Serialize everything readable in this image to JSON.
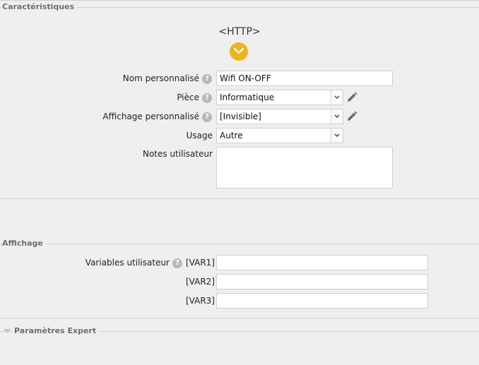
{
  "sections": {
    "characteristics": "Caractéristiques",
    "display": "Affichage",
    "expert": "Paramètres Expert"
  },
  "device": {
    "title": "<HTTP>",
    "expand_icon": "chevron-down-icon",
    "expand_color": "#f1b31c"
  },
  "fields": {
    "custom_name": {
      "label": "Nom personnalisé",
      "value": "Wifi ON-OFF"
    },
    "room": {
      "label": "Pièce",
      "value": "Informatique"
    },
    "custom_display": {
      "label": "Affichage personnalisé",
      "value": "[Invisible]"
    },
    "usage": {
      "label": "Usage",
      "value": "Autre"
    },
    "notes": {
      "label": "Notes utilisateur",
      "value": ""
    }
  },
  "variables": {
    "label": "Variables utilisateur",
    "items": [
      {
        "tag": "[VAR1]",
        "value": ""
      },
      {
        "tag": "[VAR2]",
        "value": ""
      },
      {
        "tag": "[VAR3]",
        "value": ""
      }
    ]
  },
  "help_symbol": "?"
}
